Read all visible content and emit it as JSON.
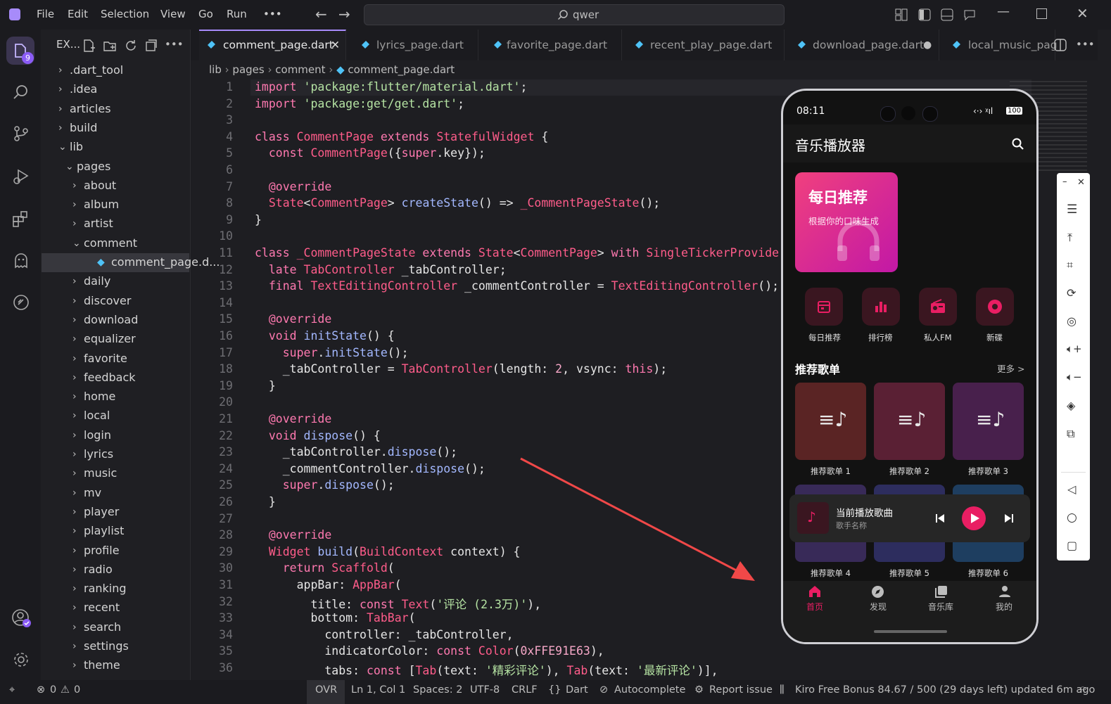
{
  "menu": [
    "File",
    "Edit",
    "Selection",
    "View",
    "Go",
    "Run",
    "•••"
  ],
  "search": {
    "value": "qwer"
  },
  "explorer": {
    "title": "EX...",
    "items": [
      {
        "label": ".dart_tool",
        "indent": 0,
        "chev": "›"
      },
      {
        "label": ".idea",
        "indent": 0,
        "chev": "›"
      },
      {
        "label": "articles",
        "indent": 0,
        "chev": "›"
      },
      {
        "label": "build",
        "indent": 0,
        "chev": "›"
      },
      {
        "label": "lib",
        "indent": 0,
        "chev": "⌄"
      },
      {
        "label": "pages",
        "indent": 1,
        "chev": "⌄"
      },
      {
        "label": "about",
        "indent": 2,
        "chev": "›"
      },
      {
        "label": "album",
        "indent": 2,
        "chev": "›"
      },
      {
        "label": "artist",
        "indent": 2,
        "chev": "›"
      },
      {
        "label": "comment",
        "indent": 2,
        "chev": "⌄"
      },
      {
        "label": "comment_page.d...",
        "indent": 3,
        "chev": "",
        "file": true
      },
      {
        "label": "daily",
        "indent": 2,
        "chev": "›"
      },
      {
        "label": "discover",
        "indent": 2,
        "chev": "›"
      },
      {
        "label": "download",
        "indent": 2,
        "chev": "›"
      },
      {
        "label": "equalizer",
        "indent": 2,
        "chev": "›"
      },
      {
        "label": "favorite",
        "indent": 2,
        "chev": "›"
      },
      {
        "label": "feedback",
        "indent": 2,
        "chev": "›"
      },
      {
        "label": "home",
        "indent": 2,
        "chev": "›"
      },
      {
        "label": "local",
        "indent": 2,
        "chev": "›"
      },
      {
        "label": "login",
        "indent": 2,
        "chev": "›"
      },
      {
        "label": "lyrics",
        "indent": 2,
        "chev": "›"
      },
      {
        "label": "music",
        "indent": 2,
        "chev": "›"
      },
      {
        "label": "mv",
        "indent": 2,
        "chev": "›"
      },
      {
        "label": "player",
        "indent": 2,
        "chev": "›"
      },
      {
        "label": "playlist",
        "indent": 2,
        "chev": "›"
      },
      {
        "label": "profile",
        "indent": 2,
        "chev": "›"
      },
      {
        "label": "radio",
        "indent": 2,
        "chev": "›"
      },
      {
        "label": "ranking",
        "indent": 2,
        "chev": "›"
      },
      {
        "label": "recent",
        "indent": 2,
        "chev": "›"
      },
      {
        "label": "search",
        "indent": 2,
        "chev": "›"
      },
      {
        "label": "settings",
        "indent": 2,
        "chev": "›"
      },
      {
        "label": "theme",
        "indent": 2,
        "chev": "›"
      }
    ]
  },
  "activity_badge": "9",
  "tabs": [
    {
      "label": "comment_page.dart",
      "active": true
    },
    {
      "label": "lyrics_page.dart"
    },
    {
      "label": "favorite_page.dart"
    },
    {
      "label": "recent_play_page.dart"
    },
    {
      "label": "download_page.dart"
    },
    {
      "label": "local_music_pag"
    }
  ],
  "breadcrumb": [
    "lib",
    "pages",
    "comment",
    "comment_page.dart"
  ],
  "code_lines": [
    [
      [
        "kw",
        "import "
      ],
      [
        "st",
        "'package:flutter/material.dart'"
      ],
      [
        "",
        "; "
      ]
    ],
    [
      [
        "kw",
        "import "
      ],
      [
        "st",
        "'package:get/get.dart'"
      ],
      [
        "",
        ";"
      ]
    ],
    [],
    [
      [
        "kw",
        "class "
      ],
      [
        "ty",
        "CommentPage "
      ],
      [
        "kw",
        "extends "
      ],
      [
        "ty",
        "StatefulWidget "
      ],
      [
        "",
        "{"
      ]
    ],
    [
      [
        "kw",
        "  const "
      ],
      [
        "ty",
        "CommentPage"
      ],
      [
        "",
        "({"
      ],
      [
        "kw",
        "super"
      ],
      [
        "",
        ".key});"
      ]
    ],
    [],
    [
      [
        "an",
        "  @override"
      ]
    ],
    [
      [
        "ty",
        "  State"
      ],
      [
        "",
        "<"
      ],
      [
        "ty",
        "CommentPage"
      ],
      [
        "",
        "> "
      ],
      [
        "fn",
        "createState"
      ],
      [
        "",
        "() => "
      ],
      [
        "ty",
        "_CommentPageState"
      ],
      [
        "",
        "();"
      ]
    ],
    [
      [
        "",
        "}"
      ]
    ],
    [],
    [
      [
        "kw",
        "class "
      ],
      [
        "ty",
        "_CommentPageState "
      ],
      [
        "kw",
        "extends "
      ],
      [
        "ty",
        "State"
      ],
      [
        "",
        "<"
      ],
      [
        "ty",
        "CommentPage"
      ],
      [
        "",
        "> "
      ],
      [
        "kw",
        "with "
      ],
      [
        "ty",
        "SingleTickerProviderSt"
      ]
    ],
    [
      [
        "kw",
        "  late "
      ],
      [
        "ty",
        "TabController "
      ],
      [
        "",
        "_tabController;"
      ]
    ],
    [
      [
        "kw",
        "  final "
      ],
      [
        "ty",
        "TextEditingController "
      ],
      [
        "",
        "_commentController = "
      ],
      [
        "ty",
        "TextEditingController"
      ],
      [
        "",
        "();"
      ]
    ],
    [],
    [
      [
        "an",
        "  @override"
      ]
    ],
    [
      [
        "kw",
        "  void "
      ],
      [
        "fn",
        "initState"
      ],
      [
        "",
        "() {"
      ]
    ],
    [
      [
        "kw",
        "    super"
      ],
      [
        "",
        "."
      ],
      [
        "fn",
        "initState"
      ],
      [
        "",
        "();"
      ]
    ],
    [
      [
        "",
        "    _tabController = "
      ],
      [
        "ty",
        "TabController"
      ],
      [
        "",
        "(length: "
      ],
      [
        "nm",
        "2"
      ],
      [
        "",
        ", vsync: "
      ],
      [
        "kw",
        "this"
      ],
      [
        "",
        ");"
      ]
    ],
    [
      [
        "",
        "  }"
      ]
    ],
    [],
    [
      [
        "an",
        "  @override"
      ]
    ],
    [
      [
        "kw",
        "  void "
      ],
      [
        "fn",
        "dispose"
      ],
      [
        "",
        "() {"
      ]
    ],
    [
      [
        "",
        "    _tabController."
      ],
      [
        "fn",
        "dispose"
      ],
      [
        "",
        "();"
      ]
    ],
    [
      [
        "",
        "    _commentController."
      ],
      [
        "fn",
        "dispose"
      ],
      [
        "",
        "();"
      ]
    ],
    [
      [
        "kw",
        "    super"
      ],
      [
        "",
        "."
      ],
      [
        "fn",
        "dispose"
      ],
      [
        "",
        "();"
      ]
    ],
    [
      [
        "",
        "  }"
      ]
    ],
    [],
    [
      [
        "an",
        "  @override"
      ]
    ],
    [
      [
        "ty",
        "  Widget "
      ],
      [
        "fn",
        "build"
      ],
      [
        "",
        "("
      ],
      [
        "ty",
        "BuildContext "
      ],
      [
        "",
        "context) {"
      ]
    ],
    [
      [
        "kw",
        "    return "
      ],
      [
        "ty",
        "Scaffold"
      ],
      [
        "",
        "("
      ]
    ],
    [
      [
        "",
        "      appBar: "
      ],
      [
        "ty",
        "AppBar"
      ],
      [
        "",
        "("
      ]
    ],
    [
      [
        "",
        "        title: "
      ],
      [
        "kw",
        "const "
      ],
      [
        "ty",
        "Text"
      ],
      [
        "",
        "("
      ],
      [
        "st",
        "'评论 (2.3万)'"
      ],
      [
        "",
        "),"
      ]
    ],
    [
      [
        "",
        "        bottom: "
      ],
      [
        "ty",
        "TabBar"
      ],
      [
        "",
        "("
      ]
    ],
    [
      [
        "",
        "          controller: _tabController,"
      ]
    ],
    [
      [
        "",
        "          indicatorColor: "
      ],
      [
        "kw",
        "const "
      ],
      [
        "ty",
        "Color"
      ],
      [
        "",
        "("
      ],
      [
        "nm",
        "0xFFE91E63"
      ],
      [
        "",
        "),"
      ]
    ],
    [
      [
        "",
        "          tabs: "
      ],
      [
        "kw",
        "const "
      ],
      [
        "",
        "["
      ],
      [
        "ty",
        "Tab"
      ],
      [
        "",
        "(text: "
      ],
      [
        "st",
        "'精彩评论'"
      ],
      [
        "",
        "), "
      ],
      [
        "ty",
        "Tab"
      ],
      [
        "",
        "(text: "
      ],
      [
        "st",
        "'最新评论'"
      ],
      [
        "",
        ")],"
      ]
    ]
  ],
  "status": {
    "errors": "0",
    "warnings": "0",
    "mode": "OVR",
    "position": "Ln 1, Col 1",
    "spaces": "Spaces: 2",
    "encoding": "UTF-8",
    "eol": "CRLF",
    "language": "Dart",
    "autocomplete": "Autocomplete",
    "report": "Report issue",
    "bonus": "Kiro Free Bonus 84.67 / 500 (29 days left) updated 6m ago"
  },
  "phone": {
    "time": "08:11",
    "battery": "100",
    "app_title": "音乐播放器",
    "daily_card": {
      "title": "每日推荐",
      "subtitle": "根据你的口味生成"
    },
    "quick_actions": [
      {
        "label": "每日推荐",
        "icon": "calendar-icon"
      },
      {
        "label": "排行榜",
        "icon": "bar-chart-icon"
      },
      {
        "label": "私人FM",
        "icon": "radio-icon"
      },
      {
        "label": "新碟",
        "icon": "disc-icon"
      }
    ],
    "section_title": "推荐歌单",
    "more": "更多 >",
    "playlists": [
      {
        "label": "推荐歌单 1",
        "color": "#5a2424"
      },
      {
        "label": "推荐歌单 2",
        "color": "#5a2034"
      },
      {
        "label": "推荐歌单 3",
        "color": "#48204c"
      },
      {
        "label": "推荐歌单 4",
        "color": "#382a58"
      },
      {
        "label": "推荐歌单 5",
        "color": "#2d2d5e"
      },
      {
        "label": "推荐歌单 6",
        "color": "#1e3e60"
      }
    ],
    "now_playing": {
      "title": "当前播放歌曲",
      "artist": "歌手名称"
    },
    "nav": [
      {
        "label": "首页",
        "icon": "home-icon",
        "active": true
      },
      {
        "label": "发现",
        "icon": "compass-icon"
      },
      {
        "label": "音乐库",
        "icon": "library-icon"
      },
      {
        "label": "我的",
        "icon": "person-icon"
      }
    ],
    "accent": "#e91e63"
  }
}
